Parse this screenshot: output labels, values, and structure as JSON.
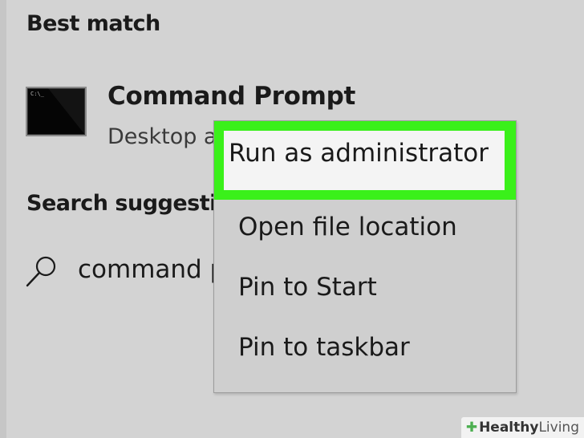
{
  "best_match": {
    "heading": "Best match"
  },
  "result": {
    "title": "Command Prompt",
    "subtitle": "Desktop a",
    "icon": "command-prompt-icon"
  },
  "suggestions": {
    "heading": "Search suggestio",
    "item_text": "command p",
    "icon": "search-icon"
  },
  "context_menu": {
    "items": [
      {
        "label": "Run as administrator",
        "highlighted": true
      },
      {
        "label": "Open file location"
      },
      {
        "label": "Pin to Start"
      },
      {
        "label": "Pin to taskbar"
      }
    ],
    "highlight_color": "#3af01a"
  },
  "watermark": {
    "part1": "Healthy",
    "part2": "Living"
  }
}
